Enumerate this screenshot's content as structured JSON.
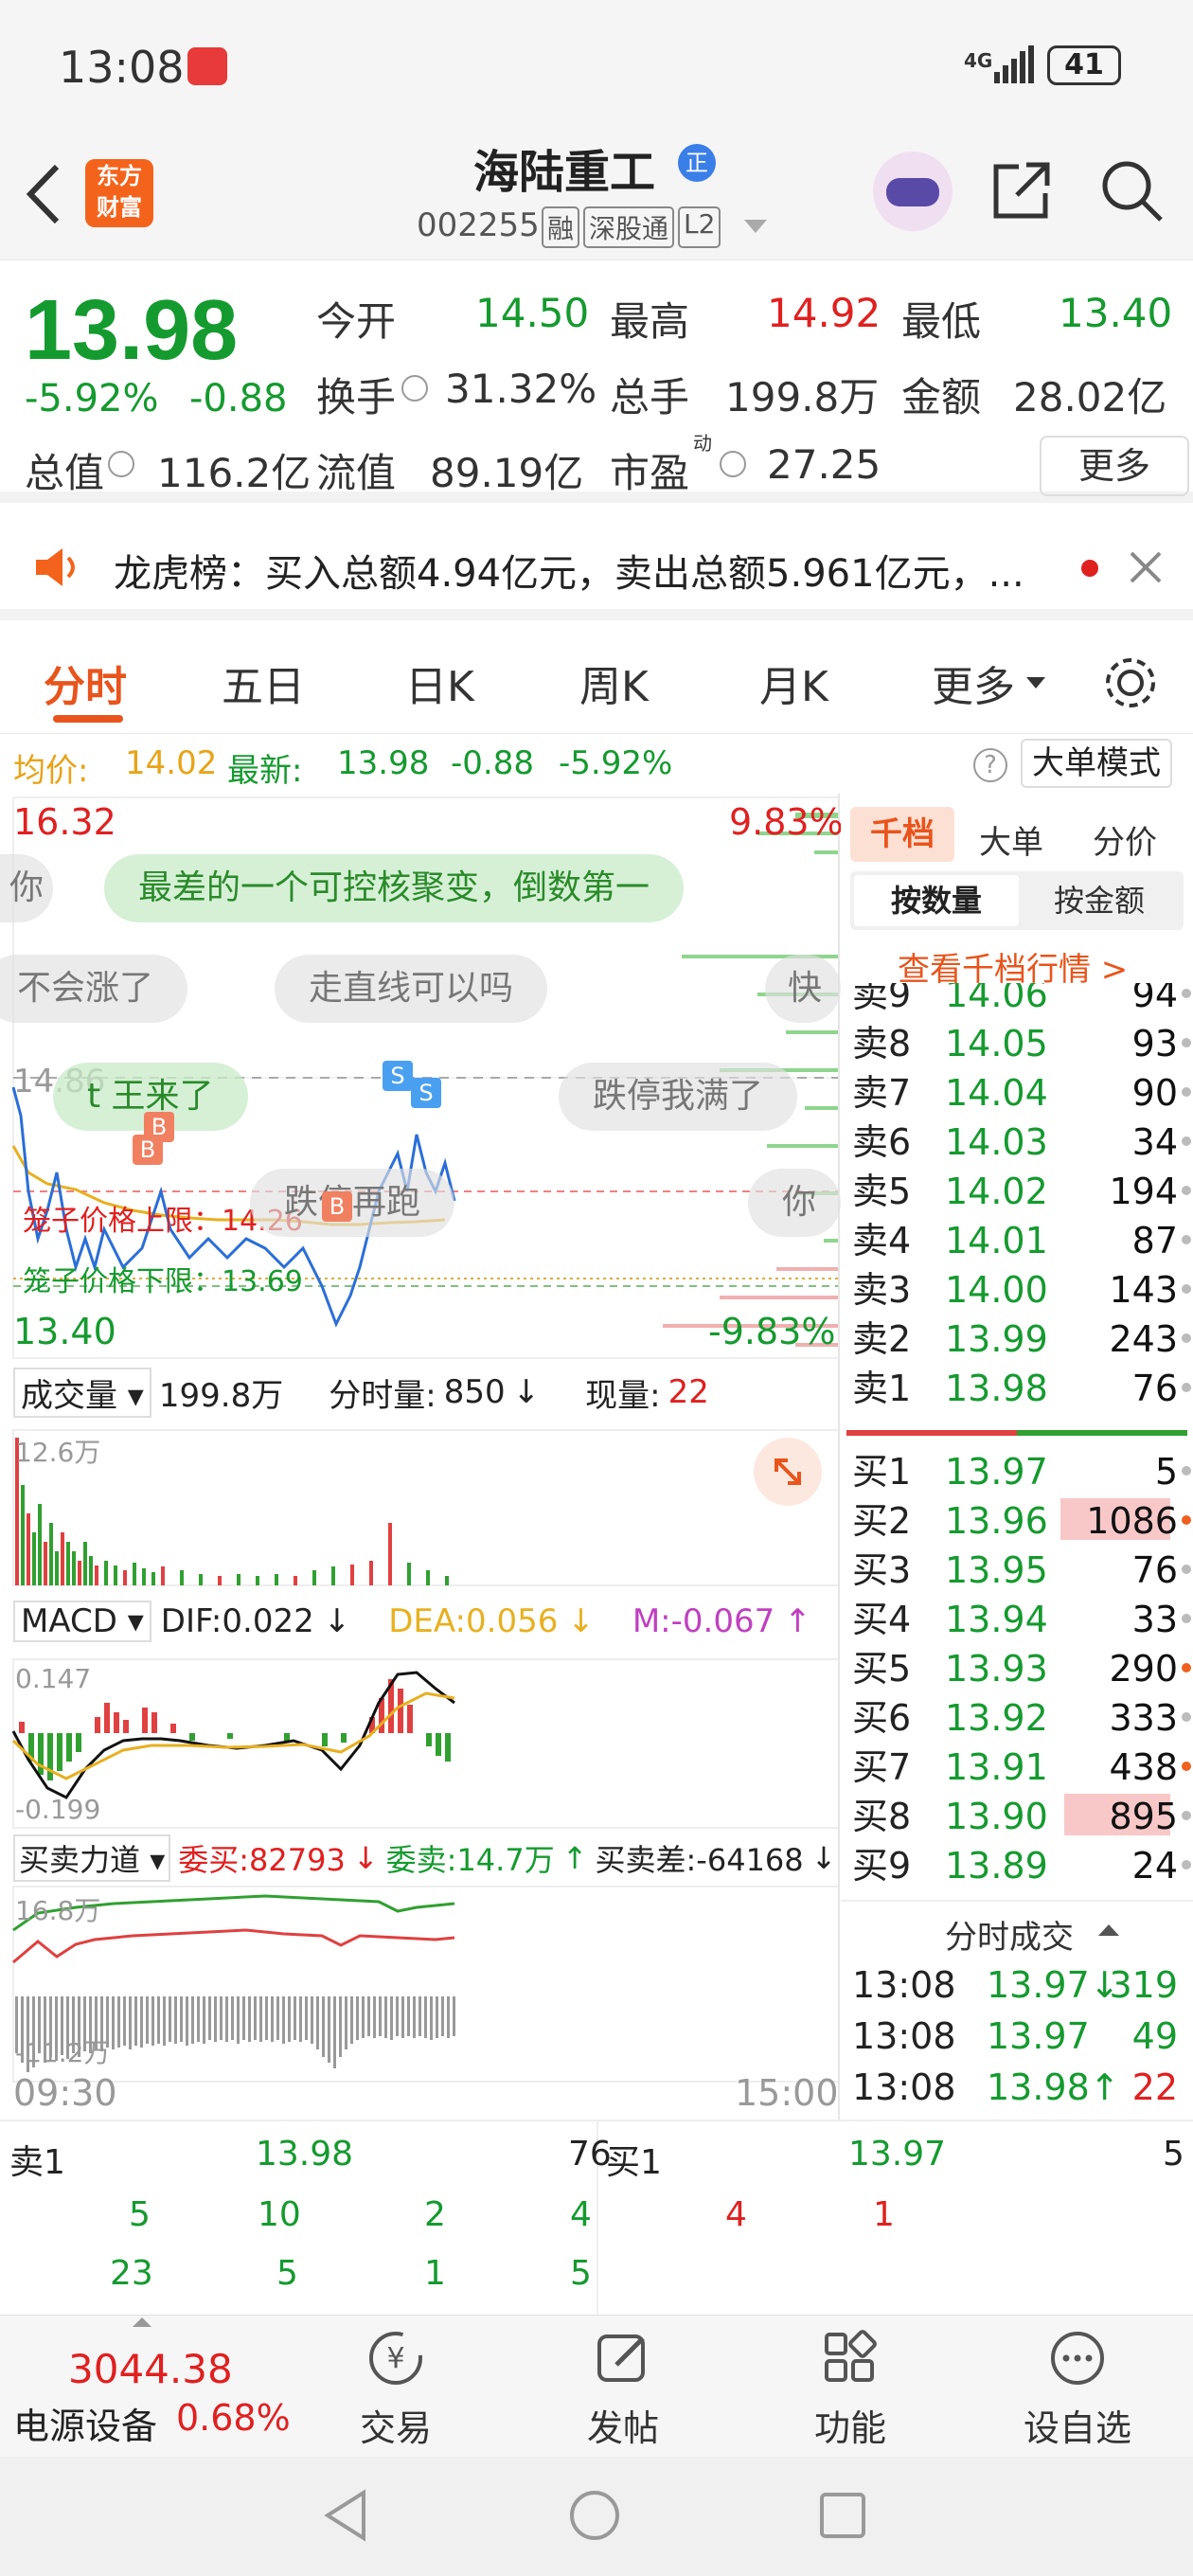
{
  "status": {
    "time": "13:08",
    "network": "4G",
    "battery": "41"
  },
  "header": {
    "logo_line1": "东方",
    "logo_line2": "财富",
    "title": "海陆重工",
    "title_badge": "正",
    "code": "002255",
    "tags": [
      "融",
      "深股通",
      "L2"
    ]
  },
  "quote": {
    "price": "13.98",
    "change_pct": "-5.92%",
    "change": "-0.88",
    "rows": [
      [
        {
          "label": "今开",
          "value": "14.50"
        },
        {
          "label": "最高",
          "value": "14.92"
        },
        {
          "label": "最低",
          "value": "13.40"
        }
      ],
      [
        {
          "label": "换手",
          "value": "31.32%"
        },
        {
          "label": "总手",
          "value": "199.8万"
        },
        {
          "label": "金额",
          "value": "28.02亿"
        }
      ],
      [
        {
          "label": "总值",
          "value": "116.2亿"
        },
        {
          "label": "流值",
          "value": "89.19亿"
        },
        {
          "label": "市盈",
          "sup": "动",
          "value": "27.25"
        }
      ]
    ],
    "more_label": "更多"
  },
  "banner": {
    "text": "龙虎榜：买入总额4.94亿元，卖出总额5.961亿元，..."
  },
  "tabs": [
    "分时",
    "五日",
    "日K",
    "周K",
    "月K",
    "更多"
  ],
  "chart_header": {
    "avg_label": "均价:",
    "avg": "14.02",
    "latest_label": "最新:",
    "latest": "13.98",
    "change": "-0.88",
    "change_pct": "-5.92%",
    "big_order_mode": "大单模式"
  },
  "intraday": {
    "price_high": "16.32",
    "price_low": "13.40",
    "pct_high": "9.83%",
    "pct_low": "-9.83%",
    "ref_price": "14.86",
    "cage_upper": "笼子价格上限：14.26",
    "cage_lower": "笼子价格下限：13.69",
    "comments": [
      "最差的一个可控核聚变，倒数第一",
      "不会涨了",
      "走直线可以吗",
      "快",
      "t 王来了",
      "跌停我满了",
      "跌停再跑",
      "你",
      "你"
    ],
    "markers": [
      "B",
      "B",
      "S",
      "S",
      "B"
    ],
    "time_start": "09:30",
    "time_end": "15:00"
  },
  "volume": {
    "label": "成交量",
    "total": "199.8万",
    "minute_label": "分时量:",
    "minute": "850",
    "now_label": "现量:",
    "now": "22",
    "max": "12.6万"
  },
  "macd": {
    "label": "MACD",
    "dif": "DIF:0.022",
    "dea": "DEA:0.056",
    "m": "M:-0.067",
    "top": "0.147",
    "bottom": "-0.199"
  },
  "force": {
    "label": "买卖力道",
    "buy": "委买:82793",
    "sell": "委卖:14.7万",
    "diff": "买卖差:-64168",
    "top": "16.8万",
    "bottom": "-11.2万"
  },
  "orderbook": {
    "tabs": [
      "千档",
      "大单",
      "分价"
    ],
    "subtabs": [
      "按数量",
      "按金额"
    ],
    "link": "查看千档行情 >",
    "asks": [
      {
        "label": "卖9",
        "price": "14.06",
        "vol": "94"
      },
      {
        "label": "卖8",
        "price": "14.05",
        "vol": "93"
      },
      {
        "label": "卖7",
        "price": "14.04",
        "vol": "90"
      },
      {
        "label": "卖6",
        "price": "14.03",
        "vol": "34"
      },
      {
        "label": "卖5",
        "price": "14.02",
        "vol": "194"
      },
      {
        "label": "卖4",
        "price": "14.01",
        "vol": "87"
      },
      {
        "label": "卖3",
        "price": "14.00",
        "vol": "143"
      },
      {
        "label": "卖2",
        "price": "13.99",
        "vol": "243"
      },
      {
        "label": "卖1",
        "price": "13.98",
        "vol": "76"
      }
    ],
    "bids": [
      {
        "label": "买1",
        "price": "13.97",
        "vol": "5"
      },
      {
        "label": "买2",
        "price": "13.96",
        "vol": "1086"
      },
      {
        "label": "买3",
        "price": "13.95",
        "vol": "76"
      },
      {
        "label": "买4",
        "price": "13.94",
        "vol": "33"
      },
      {
        "label": "买5",
        "price": "13.93",
        "vol": "290"
      },
      {
        "label": "买6",
        "price": "13.92",
        "vol": "333"
      },
      {
        "label": "买7",
        "price": "13.91",
        "vol": "438"
      },
      {
        "label": "买8",
        "price": "13.90",
        "vol": "895"
      },
      {
        "label": "买9",
        "price": "13.89",
        "vol": "24"
      }
    ],
    "trades_title": "分时成交",
    "trades": [
      {
        "time": "13:08",
        "price": "13.97↓",
        "vol": "319"
      },
      {
        "time": "13:08",
        "price": "13.97",
        "vol": "49"
      },
      {
        "time": "13:08",
        "price": "13.98↑",
        "vol": "22"
      }
    ]
  },
  "level_strip": {
    "sell_label": "卖1",
    "sell_price": "13.98",
    "sell_vol": "76",
    "buy_label": "买1",
    "buy_price": "13.97",
    "buy_vol": "5",
    "sell_row1": [
      "5",
      "10",
      "2",
      "4"
    ],
    "sell_row2": [
      "23",
      "5",
      "1",
      "5"
    ],
    "buy_row1": [
      "4",
      "1"
    ]
  },
  "bottom": {
    "index_value": "3044.38",
    "index_name": "电源设备",
    "index_change": "0.68%",
    "items": [
      "交易",
      "发帖",
      "功能",
      "设自选"
    ]
  }
}
